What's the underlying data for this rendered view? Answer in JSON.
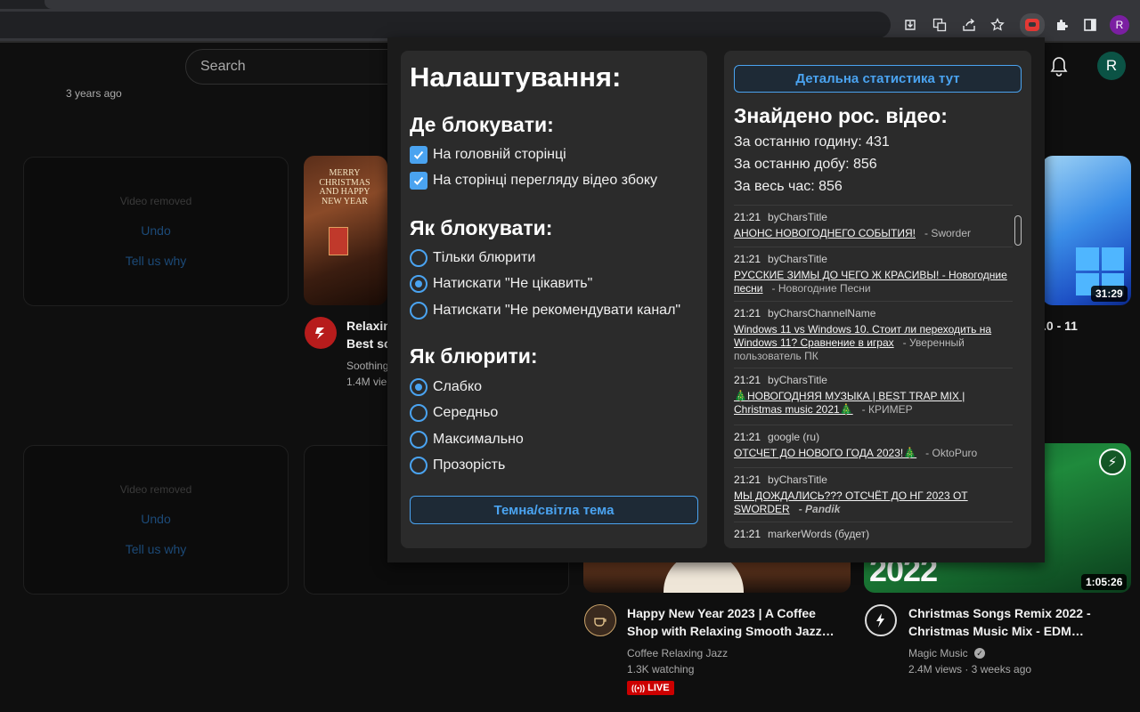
{
  "browser": {
    "profile_initial": "R",
    "toolbar_icons": [
      "download-icon",
      "translate-icon",
      "share-icon",
      "bookmark-star-icon",
      "extension-blocker-icon",
      "puzzle-extensions-icon",
      "side-panel-icon"
    ]
  },
  "youtube": {
    "search_placeholder": "Search",
    "avatar_initial": "R",
    "top_meta": "3 years ago",
    "removed_cards": [
      {
        "title": "Video removed",
        "undo": "Undo",
        "tell": "Tell us why"
      },
      {
        "title": "Video removed",
        "undo": "Undo",
        "tell": "Tell us why"
      }
    ],
    "videos": [
      {
        "title_l1": "Relaxin",
        "title_l2": "Best sc",
        "channel": "Soothing",
        "meta": "1.4M vie",
        "thumb_text": "MERRY CHRISTMAS AND HAPPY NEW YEAR"
      },
      {
        "title_l1": ".0 - 11",
        "duration": "31:29"
      },
      {
        "title_l1": "Happy New Year 2023 | A Coffee",
        "title_l2": "Shop with Relaxing Smooth Jazz…",
        "channel": "Coffee Relaxing Jazz",
        "meta": "1.3K watching",
        "live": "LIVE"
      },
      {
        "title_l1": "Christmas Songs Remix 2022 -",
        "title_l2": "Christmas Music Mix - EDM…",
        "channel": "Magic Music",
        "meta": "2.4M views · 3 weeks ago",
        "duration": "1:05:26",
        "thumb_text": "2022"
      }
    ]
  },
  "extension": {
    "settings_title": "Налаштування:",
    "where_title": "Де блокувати:",
    "where_options": [
      {
        "label": "На головній сторінці",
        "checked": true
      },
      {
        "label": "На сторінці перегляду відео збоку",
        "checked": true
      }
    ],
    "how_title": "Як блокувати:",
    "how_options": [
      {
        "label": "Тільки блюрити",
        "selected": false
      },
      {
        "label": "Натискати \"Не цікавить\"",
        "selected": true
      },
      {
        "label": "Натискати \"Не рекомендувати канал\"",
        "selected": false
      }
    ],
    "blur_title": "Як блюрити:",
    "blur_options": [
      {
        "label": "Слабко",
        "selected": true
      },
      {
        "label": "Середньо",
        "selected": false
      },
      {
        "label": "Максимально",
        "selected": false
      },
      {
        "label": "Прозорість",
        "selected": false
      }
    ],
    "theme_button": "Темна/світла тема",
    "stats_button": "Детальна статистика тут",
    "found_title": "Знайдено рос. відео:",
    "stats": {
      "last_hour": "За останню годину: 431",
      "last_day": "За останню добу: 856",
      "all_time": "За весь час: 856"
    },
    "detections": [
      {
        "time": "21:21",
        "rule": "byCharsTitle",
        "title": "АНОНС НОВОГОДНЕГО СОБЫТИЯ!",
        "channel": "- Sworder"
      },
      {
        "time": "21:21",
        "rule": "byCharsTitle",
        "title": "РУССКИЕ ЗИМЫ ДО ЧЕГО Ж КРАСИВЫ! - Новогодние песни",
        "channel": "- Новогодние Песни"
      },
      {
        "time": "21:21",
        "rule": "byCharsChannelName",
        "title": "Windows 11 vs Windows 10. Стоит ли переходить на Windows 11? Сравнение в играх",
        "channel": "- Уверенный пользователь ПК"
      },
      {
        "time": "21:21",
        "rule": "byCharsTitle",
        "title": "🎄НОВОГОДНЯЯ МУЗЫКА | BEST TRAP MIX | Christmas music 2021🎄",
        "channel": "- КРИМЕР"
      },
      {
        "time": "21:21",
        "rule": "google (ru)",
        "title": "ОТСЧЕТ ДО НОВОГО ГОДА 2023!🎄",
        "channel": "- OktoPuro"
      },
      {
        "time": "21:21",
        "rule": "byCharsTitle",
        "title": "МЫ ДОЖДАЛИСЬ??? ОТСЧЁТ ДО НГ 2023 ОТ SWORDER",
        "channel": "- Pandik"
      },
      {
        "time": "21:21",
        "rule": "markerWords (будет)",
        "title": "",
        "channel": ""
      }
    ]
  },
  "colors": {
    "accent": "#4aa3f0",
    "panel": "#2b2b2b",
    "popup_bg": "#1b1b1b",
    "live_red": "#cc0000"
  }
}
